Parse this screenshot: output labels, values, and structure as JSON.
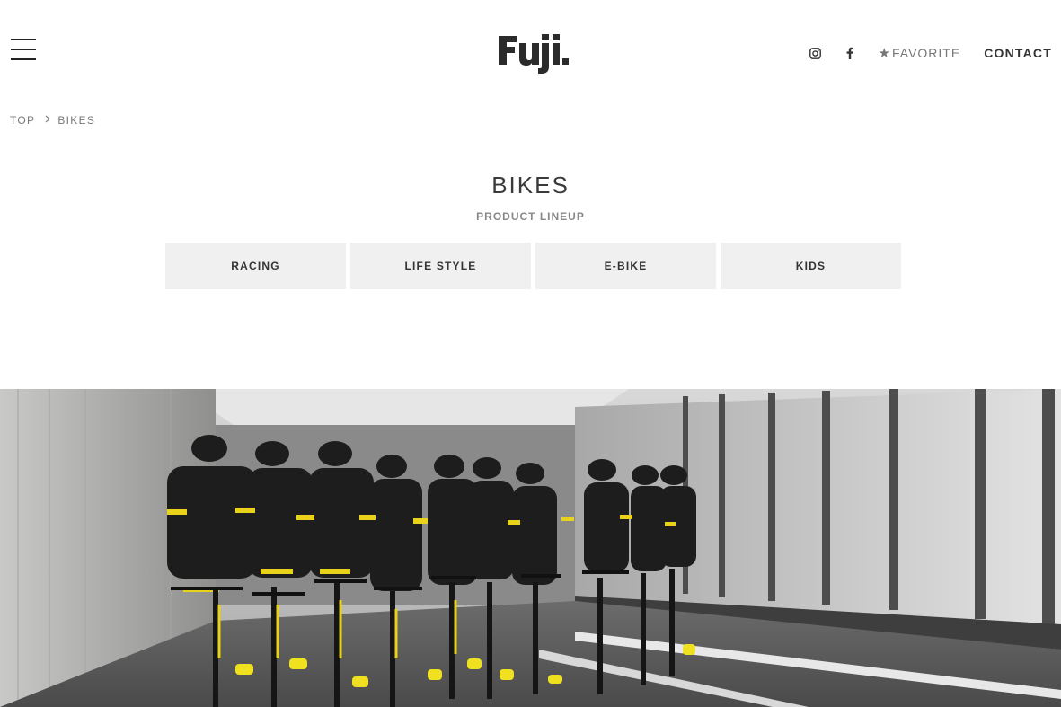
{
  "header": {
    "logo_text": "Fuji.",
    "menu_icon": "hamburger-menu-icon",
    "instagram_icon": "instagram-icon",
    "facebook_icon": "facebook-icon",
    "favorite_label": "FAVORITE",
    "favorite_icon": "star-icon",
    "contact_label": "CONTACT"
  },
  "breadcrumb": {
    "items": [
      "TOP",
      "BIKES"
    ],
    "separator_icon": "chevron-right-icon"
  },
  "page": {
    "title": "BIKES",
    "subtitle": "PRODUCT LINEUP"
  },
  "tabs": [
    {
      "label": "RACING"
    },
    {
      "label": "LIFE STYLE"
    },
    {
      "label": "E-BIKE"
    },
    {
      "label": "KIDS"
    }
  ],
  "hero": {
    "description_icon": "cyclists-in-tunnel-photo"
  },
  "colors": {
    "text_dark": "#333333",
    "text_muted": "#777777",
    "tab_bg": "#f0f0f0",
    "jersey_yellow": "#e8d21a"
  }
}
